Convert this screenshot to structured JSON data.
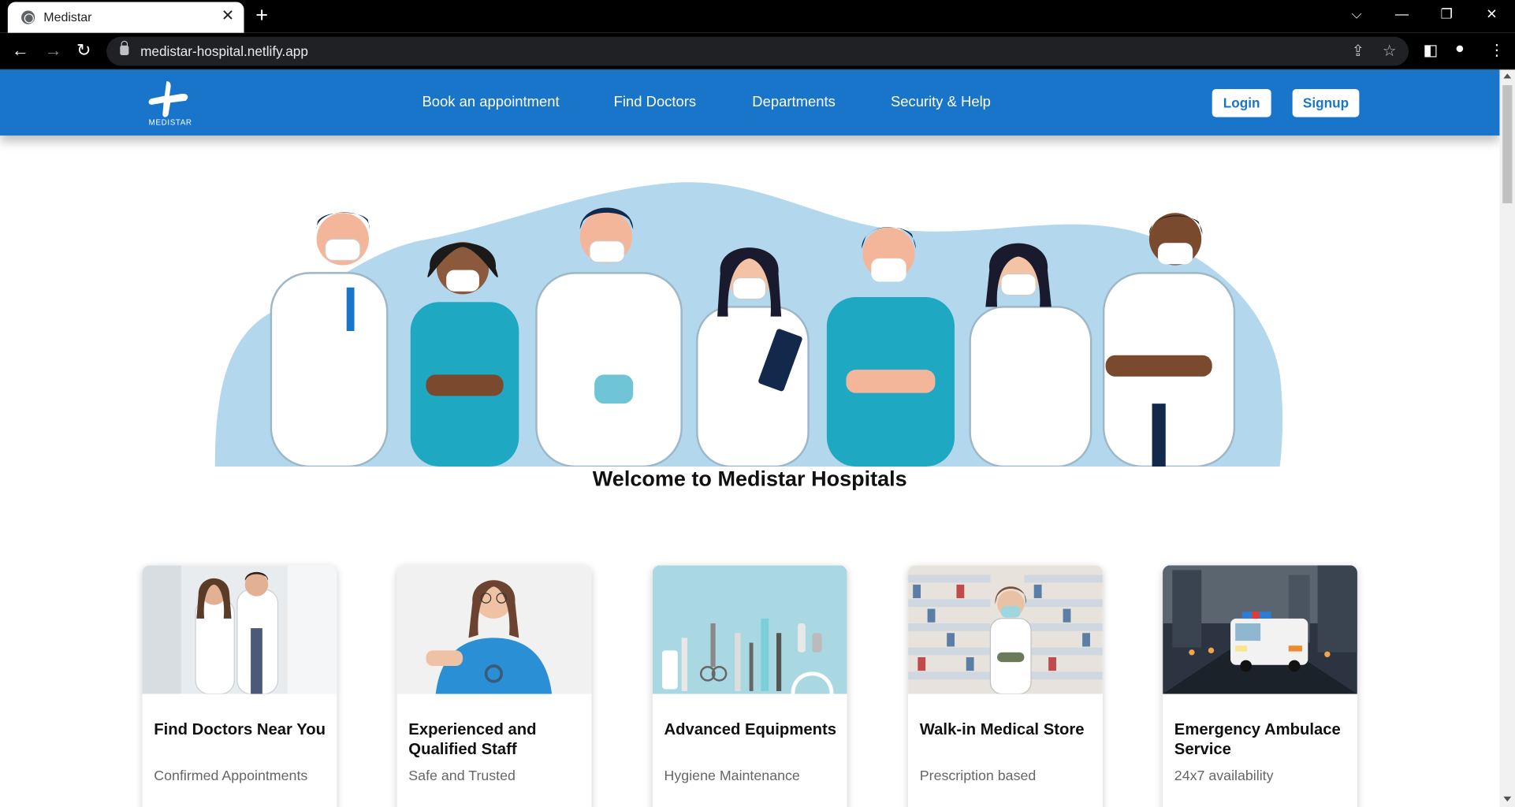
{
  "browser": {
    "tab_title": "Medistar",
    "tab_close": "✕",
    "new_tab": "+",
    "url": "medistar-hospital.netlify.app",
    "window_controls": [
      "⌵",
      "—",
      "❐",
      "✕"
    ]
  },
  "navbar": {
    "logo_text": "MEDISTAR",
    "links": [
      "Book an appointment",
      "Find Doctors",
      "Departments",
      "Security & Help"
    ],
    "login_label": "Login",
    "signup_label": "Signup"
  },
  "hero": {
    "welcome": "Welcome to Medistar Hospitals"
  },
  "cards": [
    {
      "title": "Find Doctors Near You",
      "subtitle": "Confirmed Appointments"
    },
    {
      "title": "Experienced and Qualified Staff",
      "subtitle": "Safe and Trusted"
    },
    {
      "title": "Advanced Equipments",
      "subtitle": "Hygiene Maintenance"
    },
    {
      "title": "Walk-in Medical Store",
      "subtitle": "Prescription based"
    },
    {
      "title": "Emergency Ambulace Service",
      "subtitle": "24x7 availability"
    }
  ],
  "colors": {
    "brand_blue": "#1875c9",
    "hero_blob": "#b3d8ee"
  }
}
